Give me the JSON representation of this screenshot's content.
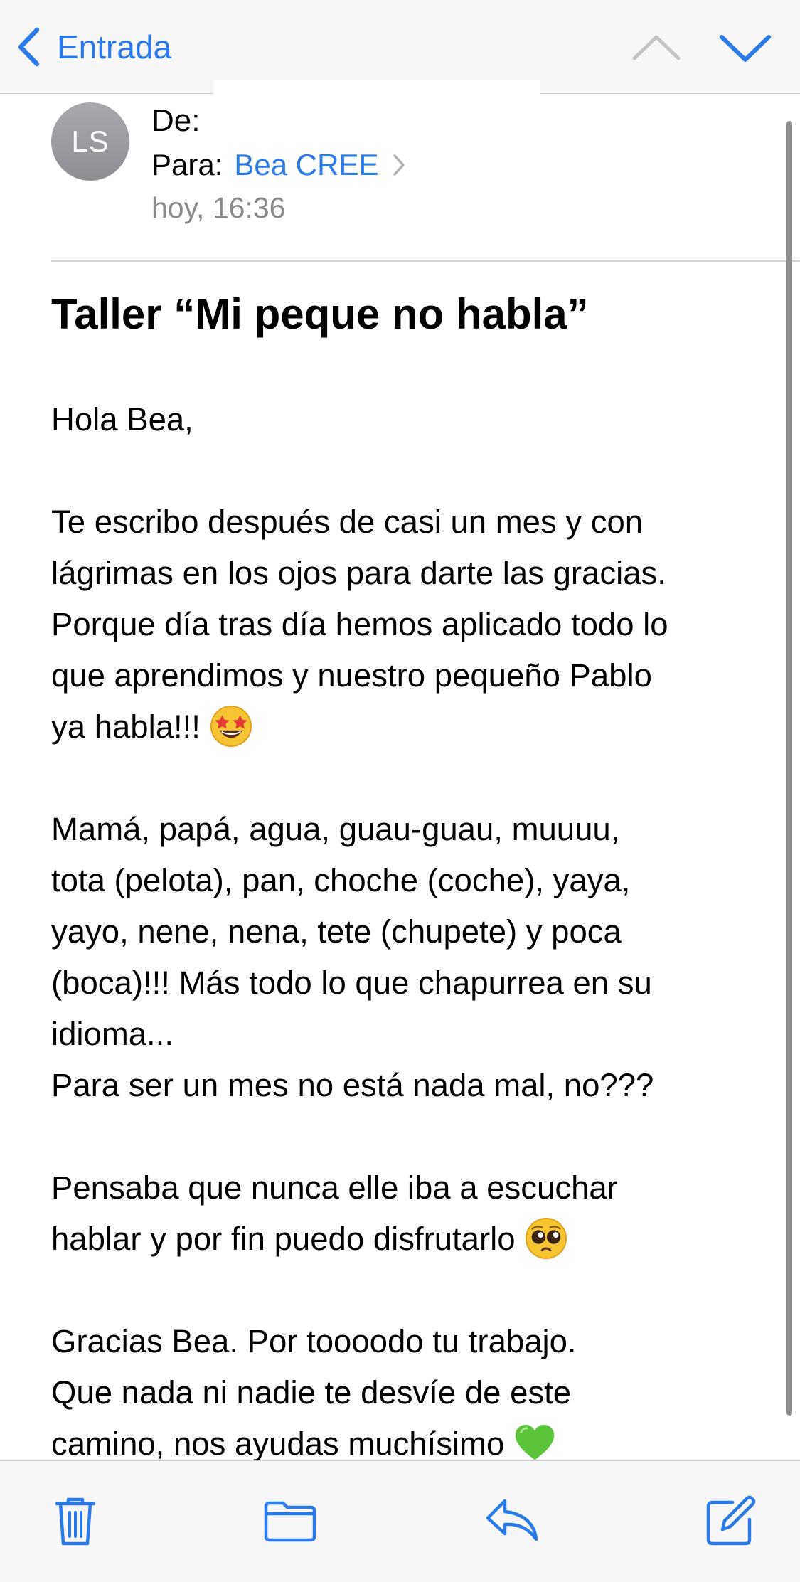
{
  "nav": {
    "back_label": "Entrada",
    "back_icon": "chevron-left-icon",
    "prev_icon": "chevron-up-icon",
    "next_icon": "chevron-down-icon"
  },
  "header": {
    "avatar_initials": "LS",
    "from_label": "De:",
    "to_label": "Para:",
    "to_name": "Bea CREE",
    "date": "hoy, 16:36"
  },
  "subject": "Taller “Mi peque no habla”",
  "body": {
    "greeting": "Hola Bea,",
    "p1": [
      "Te escribo después de casi un mes y con",
      "lágrimas en los ojos para darte las gracias.",
      "Porque día tras día hemos aplicado todo lo",
      "que aprendimos y nuestro pequeño Pablo",
      "ya habla!!!"
    ],
    "p2": [
      "Mamá, papá, agua, guau-guau, muuuu,",
      "tota (pelota), pan, choche (coche), yaya,",
      "yayo, nene, nena, tete (chupete) y poca",
      "(boca)!!! Más todo lo que chapurrea en su",
      "idioma...",
      "Para ser un mes no está nada mal, no???"
    ],
    "p3": [
      "Pensaba que nunca elle iba a escuchar",
      "hablar y por fin puedo disfrutarlo"
    ],
    "p4": [
      "Gracias Bea. Por toooodo tu trabajo.",
      "Que nada ni nadie te desvíe de este",
      "camino, nos ayudas muchísimo"
    ]
  },
  "emojis": {
    "star_struck": "star-struck-emoji",
    "pleading": "pleading-face-emoji",
    "green_heart": "green-heart-emoji"
  },
  "toolbar": {
    "trash_icon": "trash-icon",
    "folder_icon": "folder-icon",
    "reply_icon": "reply-icon",
    "compose_icon": "compose-icon"
  },
  "colors": {
    "accent": "#2a7ae8",
    "secondary_text": "#8a8a8e",
    "bar_background": "#f7f7f8"
  }
}
